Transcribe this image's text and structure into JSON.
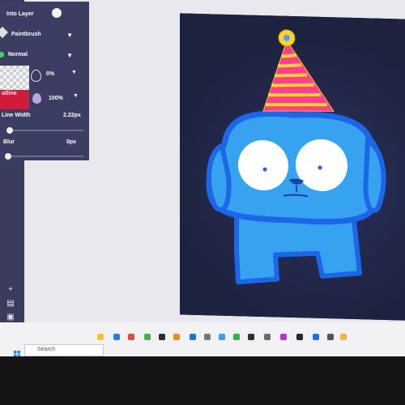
{
  "panel": {
    "into_layer_label": "Into Layer",
    "tool_label": "Paintbrush",
    "blend_mode_label": "Normal",
    "opacity_1": "0%",
    "outline_label": "utline",
    "opacity_2": "100%",
    "line_width_label": "Line Width",
    "line_width_value": "2.22px",
    "blur_label": "Blur",
    "blur_value": "0px"
  },
  "icons": [
    "add-icon",
    "folder-icon",
    "image-icon",
    "settings-icon",
    "help-icon",
    "paintbrush-icon",
    "dropdown-caret-icon",
    "opacity-drop-icon"
  ],
  "taskbar": {
    "search_placeholder": "Search"
  },
  "colors": {
    "panel_bg": "#3b3d63",
    "accent_red": "#d01b3c",
    "canvas_bg": "#1d223e",
    "creature_blue": "#36a2f0"
  }
}
